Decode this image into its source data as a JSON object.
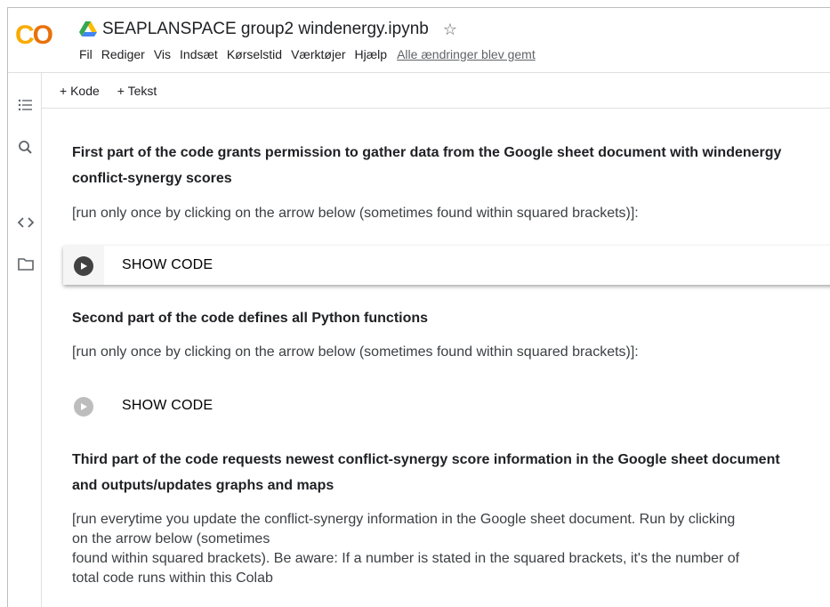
{
  "app": {
    "logo_text": "CO",
    "notebook_title": "SEAPLANSPACE group2 windenergy.ipynb",
    "menu": [
      "Fil",
      "Rediger",
      "Vis",
      "Indsæt",
      "Kørselstid",
      "Værktøjer",
      "Hjælp"
    ],
    "save_status": "Alle ændringer blev gemt"
  },
  "toolbar": {
    "add_code": "+ Kode",
    "add_text": "+ Tekst"
  },
  "sidebar": {
    "icons": [
      "table-of-contents-icon",
      "search-icon",
      "code-snippets-icon",
      "files-icon"
    ]
  },
  "cells": {
    "section1": {
      "heading_line1": "First part of the code grants permission to gather data from the Google sheet document with windenergy",
      "heading_line2": "conflict-synergy scores",
      "instruction": "[run only once by clicking on the arrow below (sometimes found within squared brackets)]:",
      "show_code": "SHOW CODE"
    },
    "section2": {
      "heading": "Second part of the code defines all Python functions",
      "instruction": "[run only once by clicking on the arrow below (sometimes found within squared brackets)]:",
      "show_code": "SHOW CODE"
    },
    "section3": {
      "heading_line1": "Third part of the code requests newest conflict-synergy score information in the Google sheet document",
      "heading_line2": "and outputs/updates graphs and  maps",
      "para_line1": "[run everytime you update the conflict-synergy information in the Google sheet document. Run by clicking",
      "para_line2": "on the arrow below (sometimes",
      "para_line3": "found within squared brackets). Be aware: If a number is stated in the squared brackets, it's the number of",
      "para_line4": "total code runs within this Colab"
    }
  },
  "colors": {
    "logo_c1": "#f9ab00",
    "logo_c2": "#e8710a",
    "run_button_active": "#424242",
    "run_button_inactive": "#bdbdbd"
  }
}
